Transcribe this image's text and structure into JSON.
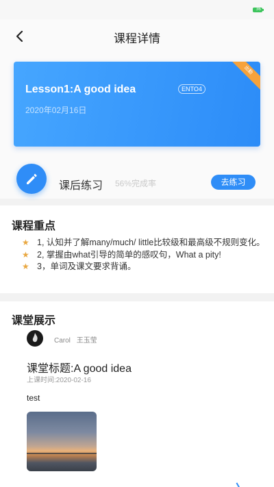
{
  "status_bar": {
    "battery_text": "36"
  },
  "nav": {
    "title": "课程详情"
  },
  "lesson": {
    "title": "Lesson1:A good idea",
    "tag": "ENTO4",
    "date": "2020年02月16日",
    "ribbon": "出勤"
  },
  "practice": {
    "label": "课后练习",
    "rate": "56%完成率",
    "button": "去练习"
  },
  "keypoints": {
    "title": "课程重点",
    "items": [
      "1, 认知并了解many/much/ little比较级和最高级不规则变化。",
      "2, 掌握由what引导的简单的感叹句，What a pity!",
      "3，单词及课文要求背诵。"
    ]
  },
  "classroom": {
    "title": "课堂展示",
    "author_en": "Carol",
    "author_cn": "王玉莹",
    "class_title": "课堂标题:A good idea",
    "class_time": "上课时间:2020-02-16",
    "content": "test"
  },
  "icons": {
    "back": "chevron-left-icon",
    "pencil": "pencil-icon",
    "star": "star-icon"
  },
  "colors": {
    "accent": "#2f8df7",
    "ribbon": "#f6a23b",
    "star": "#e9a740"
  }
}
